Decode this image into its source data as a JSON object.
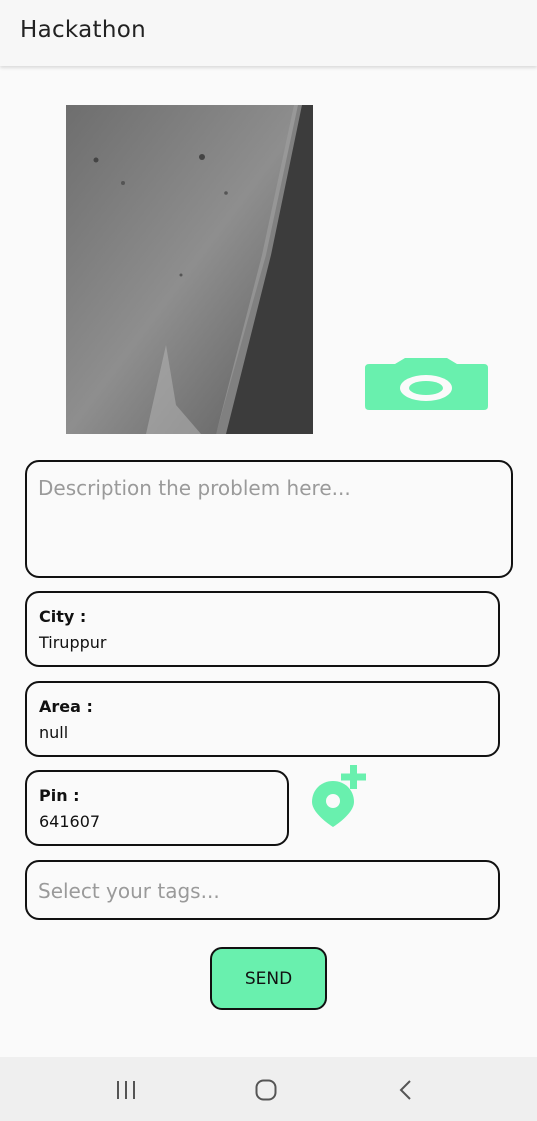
{
  "app": {
    "title": "Hackathon"
  },
  "form": {
    "description_placeholder": "Description the problem here...",
    "city": {
      "label": "City :",
      "value": "Tiruppur"
    },
    "area": {
      "label": "Area :",
      "value": "null"
    },
    "pin": {
      "label": "Pin :",
      "value": "641607"
    },
    "tags_placeholder": "Select your tags...",
    "send_label": "SEND"
  },
  "icons": {
    "camera": "camera-icon",
    "add_location": "add-location-icon",
    "nav_recent": "recent-apps-icon",
    "nav_home": "home-icon",
    "nav_back": "back-icon"
  },
  "colors": {
    "accent": "#69f0ae",
    "border": "#111111",
    "background": "#fafafa"
  }
}
